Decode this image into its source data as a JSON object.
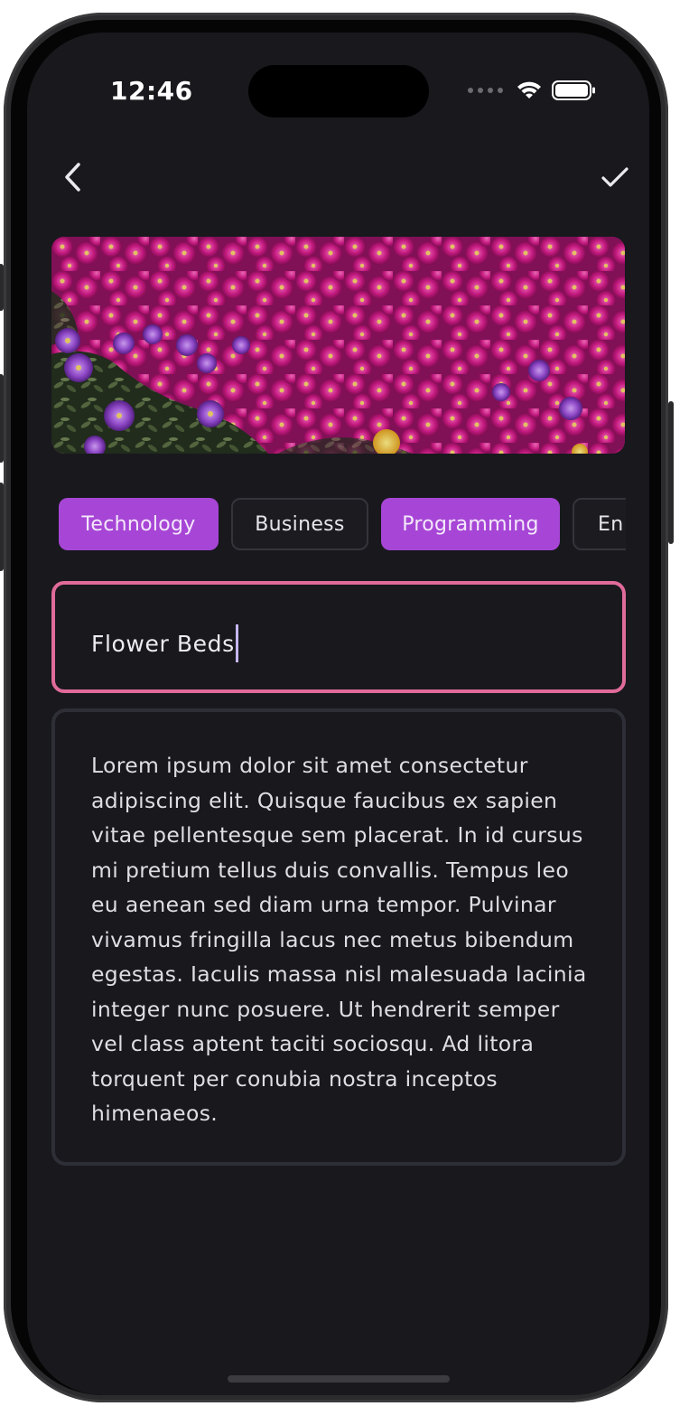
{
  "status_bar": {
    "time": "12:46"
  },
  "nav": {
    "back_icon": "chevron-left-icon",
    "confirm_icon": "checkmark-icon"
  },
  "hero_image": {
    "subject": "flower-bed-photo",
    "colors": [
      "#c2187f",
      "#8a2fb0",
      "#e63aa0",
      "#2d3a25"
    ]
  },
  "categories": [
    {
      "label": "Technology",
      "selected": true
    },
    {
      "label": "Business",
      "selected": false
    },
    {
      "label": "Programming",
      "selected": true
    },
    {
      "label": "En",
      "selected": false
    }
  ],
  "title_field": {
    "value": "Flower Beds"
  },
  "body_field": {
    "value": "Lorem ipsum dolor sit amet consectetur adipiscing elit. Quisque faucibus ex sapien vitae pellentesque sem placerat. In id cursus mi pretium tellus duis convallis. Tempus leo eu aenean sed diam urna tempor. Pulvinar vivamus fringilla lacus nec metus bibendum egestas. Iaculis massa nisl malesuada lacinia integer nunc posuere. Ut hendrerit semper vel class aptent taciti sociosqu. Ad litora torquent per conubia nostra inceptos himenaeos."
  },
  "colors": {
    "background": "#18181d",
    "accent_chip": "#a746d6",
    "focus_border": "#e06b9a",
    "caret": "#c6b6f4"
  }
}
